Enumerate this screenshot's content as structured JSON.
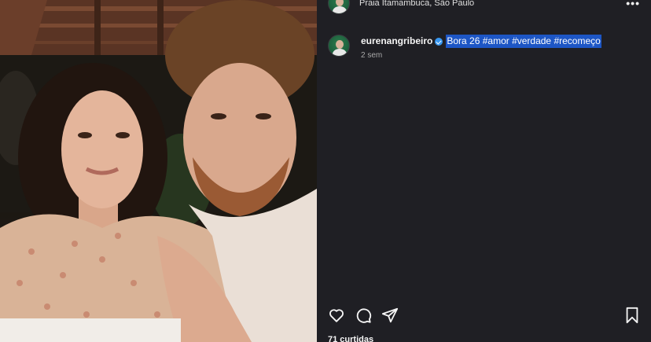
{
  "post": {
    "location": "Praia Itamambuca, São Paulo",
    "username": "eurenangribeiro",
    "caption_highlighted": "Bora 26 #amor #verdade #recomeço",
    "time_ago": "2 sem",
    "likes": "71 curtidas"
  },
  "icons": {
    "like": "heart-icon",
    "comment": "comment-icon",
    "share": "send-icon",
    "save": "bookmark-icon",
    "more": "more-options-icon",
    "verified": "verified-badge-icon"
  },
  "colors": {
    "panel_bg": "#1f1f24",
    "selection": "#1d56c5",
    "verified": "#3897f0",
    "muted_text": "#a8a8a8"
  }
}
